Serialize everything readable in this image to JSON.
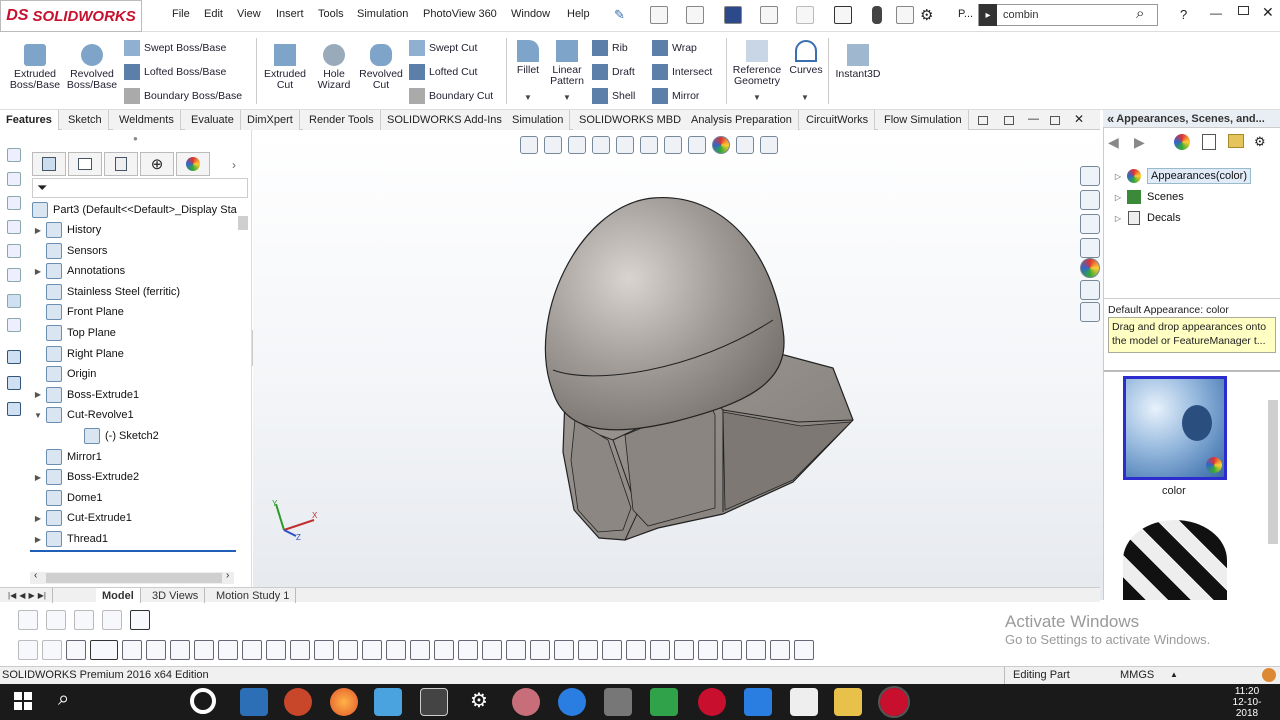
{
  "app": {
    "logo": "SOLIDWORKS",
    "logo_mark": "DS"
  },
  "menu": [
    "File",
    "Edit",
    "View",
    "Insert",
    "Tools",
    "Simulation",
    "PhotoView 360",
    "Window",
    "Help"
  ],
  "quick_title_short": "P...",
  "search": {
    "value": "combin",
    "help": "?"
  },
  "commands": {
    "extruded_boss": "Extruded\nBoss/Base",
    "revolved_boss": "Revolved\nBoss/Base",
    "swept_boss": "Swept Boss/Base",
    "lofted_boss": "Lofted Boss/Base",
    "boundary_boss": "Boundary Boss/Base",
    "extruded_cut": "Extruded\nCut",
    "hole_wizard": "Hole\nWizard",
    "revolved_cut": "Revolved\nCut",
    "swept_cut": "Swept Cut",
    "lofted_cut": "Lofted Cut",
    "boundary_cut": "Boundary Cut",
    "fillet": "Fillet",
    "linear_pattern": "Linear\nPattern",
    "rib": "Rib",
    "draft": "Draft",
    "shell": "Shell",
    "wrap": "Wrap",
    "intersect": "Intersect",
    "mirror": "Mirror",
    "reference_geometry": "Reference\nGeometry",
    "curves": "Curves",
    "instant3d": "Instant3D"
  },
  "tabs": [
    "Features",
    "Sketch",
    "Weldments",
    "Evaluate",
    "DimXpert",
    "Render Tools",
    "SOLIDWORKS Add-Ins",
    "Simulation",
    "SOLIDWORKS MBD",
    "Analysis Preparation",
    "CircuitWorks",
    "Flow Simulation"
  ],
  "feature_tree": {
    "root": "Part3  (Default<<Default>_Display Sta",
    "items": [
      {
        "label": "History",
        "expand": true
      },
      {
        "label": "Sensors",
        "expand": false
      },
      {
        "label": "Annotations",
        "expand": true
      },
      {
        "label": "Stainless Steel (ferritic)",
        "expand": false
      },
      {
        "label": "Front Plane",
        "expand": false
      },
      {
        "label": "Top Plane",
        "expand": false
      },
      {
        "label": "Right Plane",
        "expand": false
      },
      {
        "label": "Origin",
        "expand": false
      },
      {
        "label": "Boss-Extrude1",
        "expand": true
      },
      {
        "label": "Cut-Revolve1",
        "expand": true,
        "open": true
      },
      {
        "label": "(-) Sketch2",
        "expand": false,
        "child": true
      },
      {
        "label": "Mirror1",
        "expand": false
      },
      {
        "label": "Boss-Extrude2",
        "expand": true
      },
      {
        "label": "Dome1",
        "expand": false
      },
      {
        "label": "Cut-Extrude1",
        "expand": true
      },
      {
        "label": "Thread1",
        "expand": true
      }
    ]
  },
  "bottom_tabs": [
    "Model",
    "3D Views",
    "Motion Study 1"
  ],
  "task_pane": {
    "title": "Appearances, Scenes, and...",
    "tree": [
      "Appearances(color)",
      "Scenes",
      "Decals"
    ],
    "default_appearance": "Default Appearance: color",
    "tooltip_line1": "Drag and drop appearances onto",
    "tooltip_line2": "the model or FeatureManager t...",
    "swatch_label": "color"
  },
  "triad": {
    "x": "X",
    "y": "Y",
    "z": "Z"
  },
  "watermark": {
    "line1": "Activate Windows",
    "line2": "Go to Settings to activate Windows."
  },
  "status": {
    "edition": "SOLIDWORKS Premium 2016 x64 Edition",
    "mode": "Editing Part",
    "units": "MMGS"
  },
  "clock": {
    "time": "11:20",
    "date": "12-10-2018"
  },
  "colors": {
    "brand": "#c8102e",
    "accent": "#1f5fb8",
    "taskbar": "#1a1a1a",
    "selection_blue": "#2c2ccf"
  }
}
